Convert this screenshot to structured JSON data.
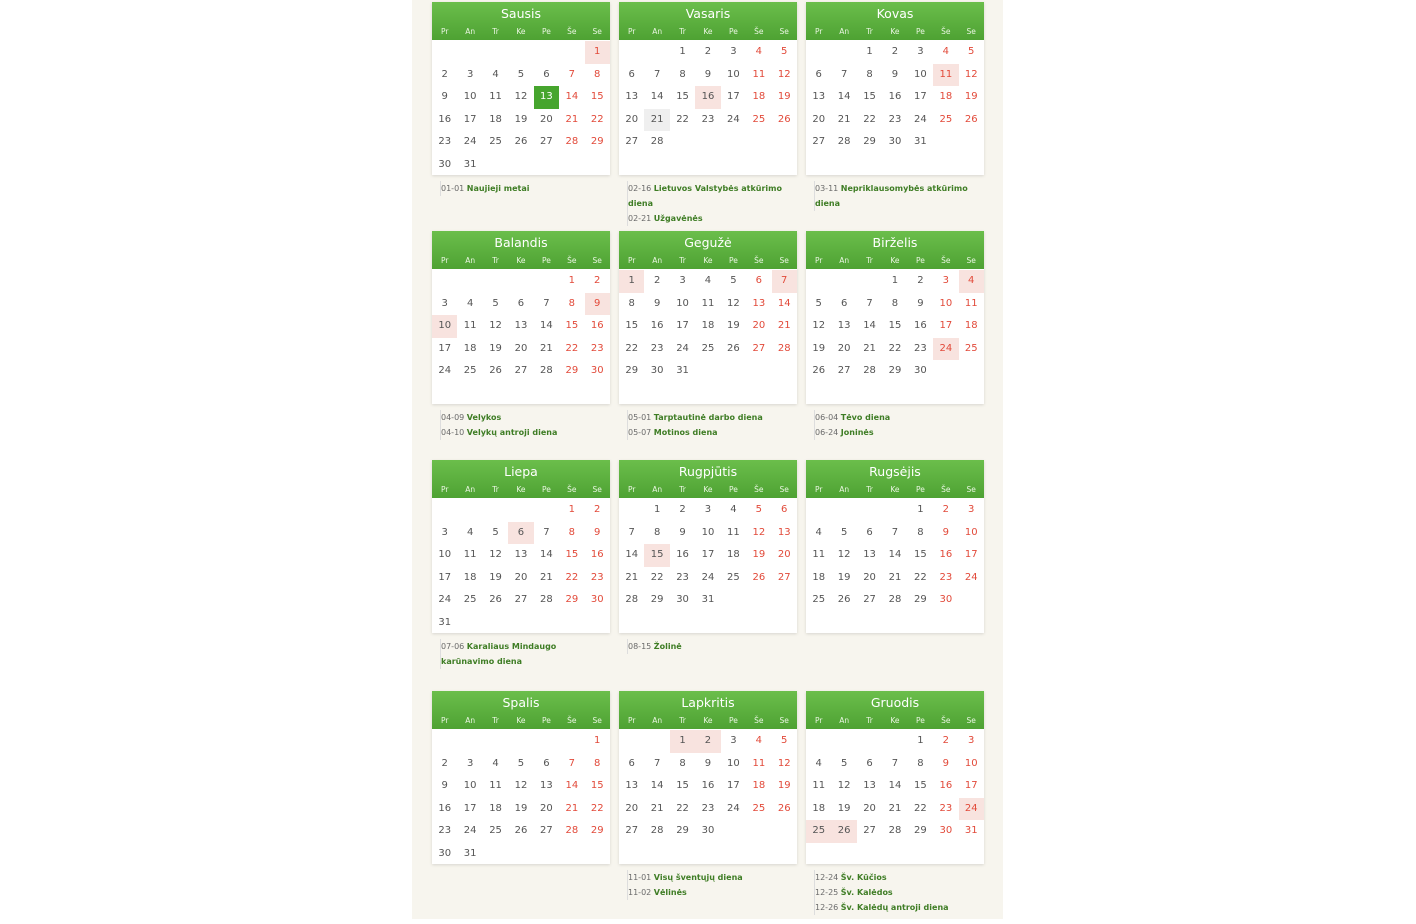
{
  "weekday_labels": [
    "Pr",
    "An",
    "Tr",
    "Ke",
    "Pe",
    "Še",
    "Se"
  ],
  "colors": {
    "header_green": "#4ea233",
    "weekend_red": "#e24a3a",
    "holiday_bg": "#f8e3df",
    "today_bg": "#46a52e",
    "holiday_name": "#3f7d25"
  },
  "today": {
    "month": 1,
    "day": 13
  },
  "months": [
    {
      "name": "Sausis",
      "days": 31,
      "offset": 6,
      "holiday_days": [
        1
      ],
      "holidays": [
        {
          "date": "01-01",
          "name": "Naujieji metai"
        }
      ]
    },
    {
      "name": "Vasaris",
      "days": 28,
      "offset": 2,
      "holiday_days": [
        16
      ],
      "muted_days": [
        21
      ],
      "holidays": [
        {
          "date": "02-16",
          "name": "Lietuvos Valstybės atkūrimo diena"
        },
        {
          "date": "02-21",
          "name": "Užgavėnės"
        }
      ]
    },
    {
      "name": "Kovas",
      "days": 31,
      "offset": 2,
      "holiday_days": [
        11
      ],
      "holidays": [
        {
          "date": "03-11",
          "name": "Nepriklausomybės atkūrimo diena"
        }
      ]
    },
    {
      "name": "Balandis",
      "days": 30,
      "offset": 5,
      "holiday_days": [
        9,
        10
      ],
      "holidays": [
        {
          "date": "04-09",
          "name": "Velykos"
        },
        {
          "date": "04-10",
          "name": "Velykų antroji diena"
        }
      ]
    },
    {
      "name": "Gegužė",
      "days": 31,
      "offset": 0,
      "holiday_days": [
        1,
        7
      ],
      "holidays": [
        {
          "date": "05-01",
          "name": "Tarptautinė darbo diena"
        },
        {
          "date": "05-07",
          "name": "Motinos diena"
        }
      ]
    },
    {
      "name": "Birželis",
      "days": 30,
      "offset": 3,
      "holiday_days": [
        4,
        24
      ],
      "holidays": [
        {
          "date": "06-04",
          "name": "Tėvo diena"
        },
        {
          "date": "06-24",
          "name": "Joninės"
        }
      ]
    },
    {
      "name": "Liepa",
      "days": 31,
      "offset": 5,
      "holiday_days": [
        6
      ],
      "holidays": [
        {
          "date": "07-06",
          "name": "Karaliaus Mindaugo karūnavimo diena"
        }
      ]
    },
    {
      "name": "Rugpjūtis",
      "days": 31,
      "offset": 1,
      "holiday_days": [
        15
      ],
      "holidays": [
        {
          "date": "08-15",
          "name": "Žolinė"
        }
      ]
    },
    {
      "name": "Rugsėjis",
      "days": 30,
      "offset": 4,
      "holiday_days": [],
      "holidays": []
    },
    {
      "name": "Spalis",
      "days": 31,
      "offset": 6,
      "holiday_days": [],
      "holidays": []
    },
    {
      "name": "Lapkritis",
      "days": 30,
      "offset": 2,
      "holiday_days": [
        1,
        2
      ],
      "holidays": [
        {
          "date": "11-01",
          "name": "Visų šventųjų diena"
        },
        {
          "date": "11-02",
          "name": "Vėlinės"
        }
      ]
    },
    {
      "name": "Gruodis",
      "days": 31,
      "offset": 4,
      "holiday_days": [
        24,
        25,
        26
      ],
      "holidays": [
        {
          "date": "12-24",
          "name": "Šv. Kūčios"
        },
        {
          "date": "12-25",
          "name": "Šv. Kalėdos"
        },
        {
          "date": "12-26",
          "name": "Šv. Kalėdų antroji diena"
        }
      ]
    }
  ]
}
